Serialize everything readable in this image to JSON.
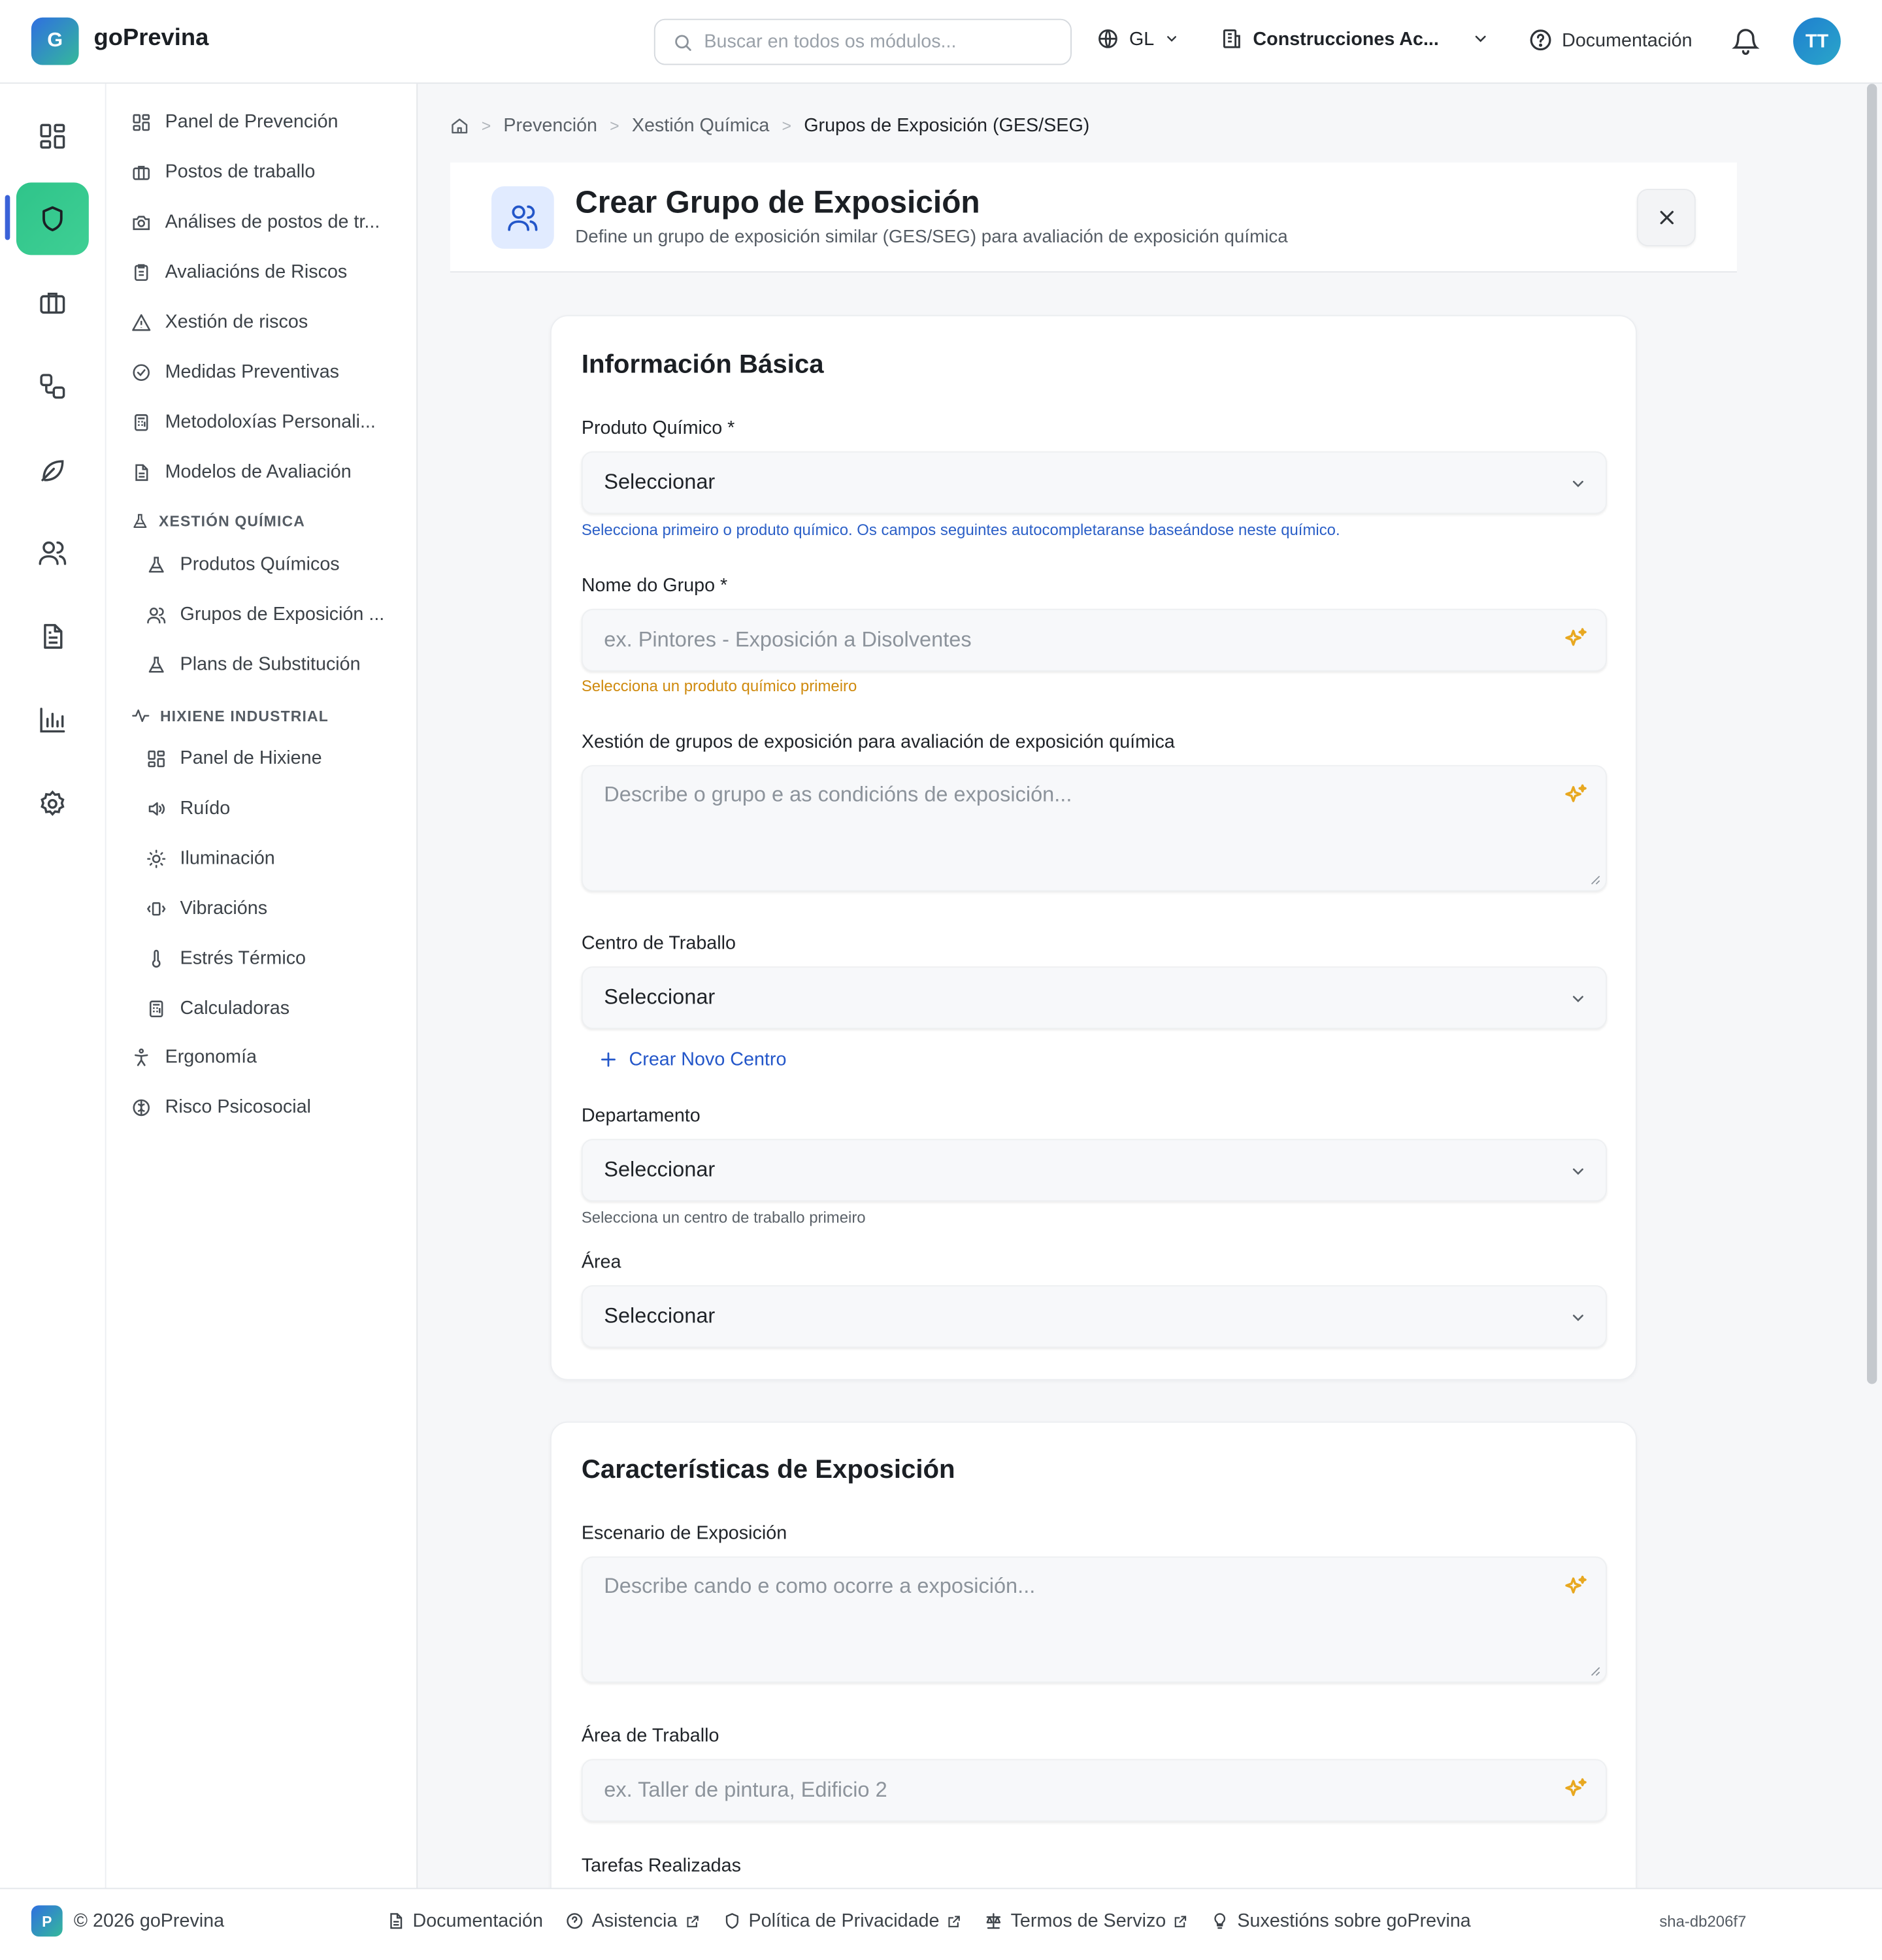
{
  "app": {
    "logo_letter": "G",
    "name": "goPrevina"
  },
  "topbar": {
    "search_placeholder": "Buscar en todos os módulos...",
    "language": "GL",
    "company": "Construcciones Ac...",
    "documentation": "Documentación",
    "user_initials": "TT"
  },
  "rail": {
    "items": [
      {
        "icon": "dashboard-icon"
      },
      {
        "icon": "shield-icon",
        "active": true
      },
      {
        "icon": "briefcase-icon"
      },
      {
        "icon": "workflow-icon"
      },
      {
        "icon": "leaf-icon"
      },
      {
        "icon": "users-icon"
      },
      {
        "icon": "document-icon"
      },
      {
        "icon": "bar-chart-icon"
      },
      {
        "icon": "settings-icon"
      }
    ]
  },
  "sidebar": {
    "items": [
      {
        "label": "Panel de Prevención",
        "icon": "dashboard-icon"
      },
      {
        "label": "Postos de traballo",
        "icon": "briefcase-icon"
      },
      {
        "label": "Análises de postos de tr...",
        "icon": "camera-icon"
      },
      {
        "label": "Avaliacións de Riscos",
        "icon": "clipboard-icon"
      },
      {
        "label": "Xestión de riscos",
        "icon": "warning-icon"
      },
      {
        "label": "Medidas Preventivas",
        "icon": "check-circle-icon"
      },
      {
        "label": "Metodoloxías Personali...",
        "icon": "calculator-icon"
      },
      {
        "label": "Modelos de Avaliación",
        "icon": "file-icon"
      }
    ],
    "section_chemical": {
      "title": "XESTIÓN QUÍMICA",
      "items": [
        {
          "label": "Produtos Químicos",
          "icon": "flask-icon"
        },
        {
          "label": "Grupos de Exposición ...",
          "icon": "users-icon"
        },
        {
          "label": "Plans de Substitución",
          "icon": "flask-icon"
        }
      ]
    },
    "section_hygiene": {
      "title": "HIXIENE INDUSTRIAL",
      "items": [
        {
          "label": "Panel de Hixiene",
          "icon": "dashboard-icon"
        },
        {
          "label": "Ruído",
          "icon": "speaker-icon"
        },
        {
          "label": "Iluminación",
          "icon": "sun-icon"
        },
        {
          "label": "Vibracións",
          "icon": "vibration-icon"
        },
        {
          "label": "Estrés Térmico",
          "icon": "thermometer-icon"
        },
        {
          "label": "Calculadoras",
          "icon": "calculator-icon"
        }
      ]
    },
    "bottom_items": [
      {
        "label": "Ergonomía",
        "icon": "person-icon"
      },
      {
        "label": "Risco Psicosocial",
        "icon": "brain-icon"
      }
    ]
  },
  "breadcrumb": {
    "items": [
      "Prevención",
      "Xestión Química",
      "Grupos de Exposición (GES/SEG)"
    ]
  },
  "header": {
    "title": "Crear Grupo de Exposición",
    "subtitle": "Define un grupo de exposición similar (GES/SEG) para avaliación de exposición química"
  },
  "basic_info": {
    "title": "Información Básica",
    "product_label": "Produto Químico *",
    "product_value": "Seleccionar",
    "product_hint": "Selecciona primeiro o produto químico. Os campos seguintes autocompletaranse baseándose neste químico.",
    "group_name_label": "Nome do Grupo *",
    "group_name_placeholder": "ex. Pintores - Exposición a Disolventes",
    "group_name_hint": "Selecciona un produto químico primeiro",
    "description_label": "Xestión de grupos de exposición para avaliación de exposición química",
    "description_placeholder": "Describe o grupo e as condicións de exposición...",
    "workcenter_label": "Centro de Traballo",
    "workcenter_value": "Seleccionar",
    "create_center": "Crear Novo Centro",
    "department_label": "Departamento",
    "department_value": "Seleccionar",
    "department_hint": "Selecciona un centro de traballo primeiro",
    "area_label": "Área",
    "area_value": "Seleccionar"
  },
  "exposure": {
    "title": "Características de Exposición",
    "scenario_label": "Escenario de Exposición",
    "scenario_placeholder": "Describe cando e como ocorre a exposición...",
    "work_area_label": "Área de Traballo",
    "work_area_placeholder": "ex. Taller de pintura, Edificio 2",
    "tasks_label": "Tarefas Realizadas"
  },
  "footer": {
    "logo_letter": "P",
    "copyright": "© 2026 goPrevina",
    "links": [
      "Documentación",
      "Asistencia",
      "Política de Privacidade",
      "Termos de Servizo",
      "Suxestións sobre goPrevina"
    ],
    "sha": "sha-db206f7"
  },
  "colors": {
    "accent": "#2356c9",
    "active_green": "#2fc48a",
    "warning": "#cf8a0e",
    "sparkle": "#e8a820"
  }
}
